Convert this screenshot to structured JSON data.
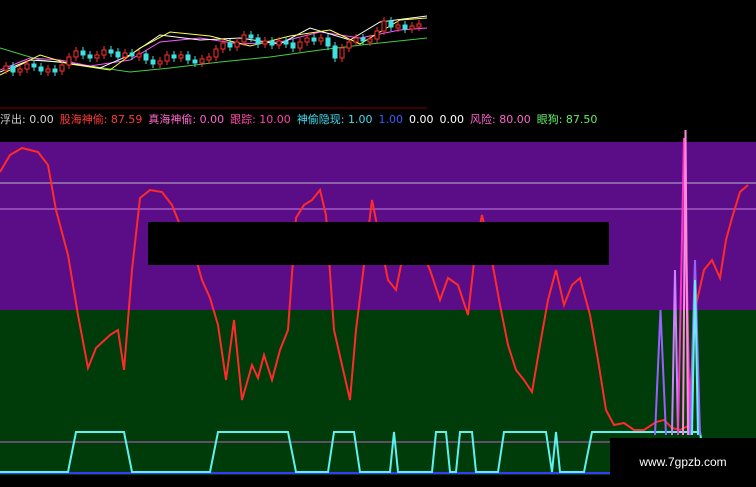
{
  "indicators": [
    {
      "label": "浮出",
      "value": "0.00",
      "color": "#d0d0d0"
    },
    {
      "label": "股海神偷",
      "value": "87.59",
      "color": "#ff3b3b"
    },
    {
      "label": "真海神偷",
      "value": "0.00",
      "color": "#ff66cc"
    },
    {
      "label": "跟踪",
      "value": "10.00",
      "color": "#ff44aa"
    },
    {
      "label": "神偷隐现",
      "value": "1.00",
      "color": "#44ddee"
    },
    {
      "label": "",
      "value": "1.00",
      "color": "#3a5cff"
    },
    {
      "label": "",
      "value": "0.00",
      "color": "#ffffff"
    },
    {
      "label": "",
      "value": "0.00",
      "color": "#ffffff"
    },
    {
      "label": "风险",
      "value": "80.00",
      "color": "#ff66cc"
    },
    {
      "label": "眼狗",
      "value": "87.50",
      "color": "#66ee66"
    }
  ],
  "watermark": "www.7gpzb.com",
  "colors": {
    "purple_band": "#5a0d86",
    "green_band": "#003b0a",
    "red_line": "#ff2a2a",
    "cyan_line": "#5ff0f0",
    "magenta_spike": "#ff33cc"
  }
}
